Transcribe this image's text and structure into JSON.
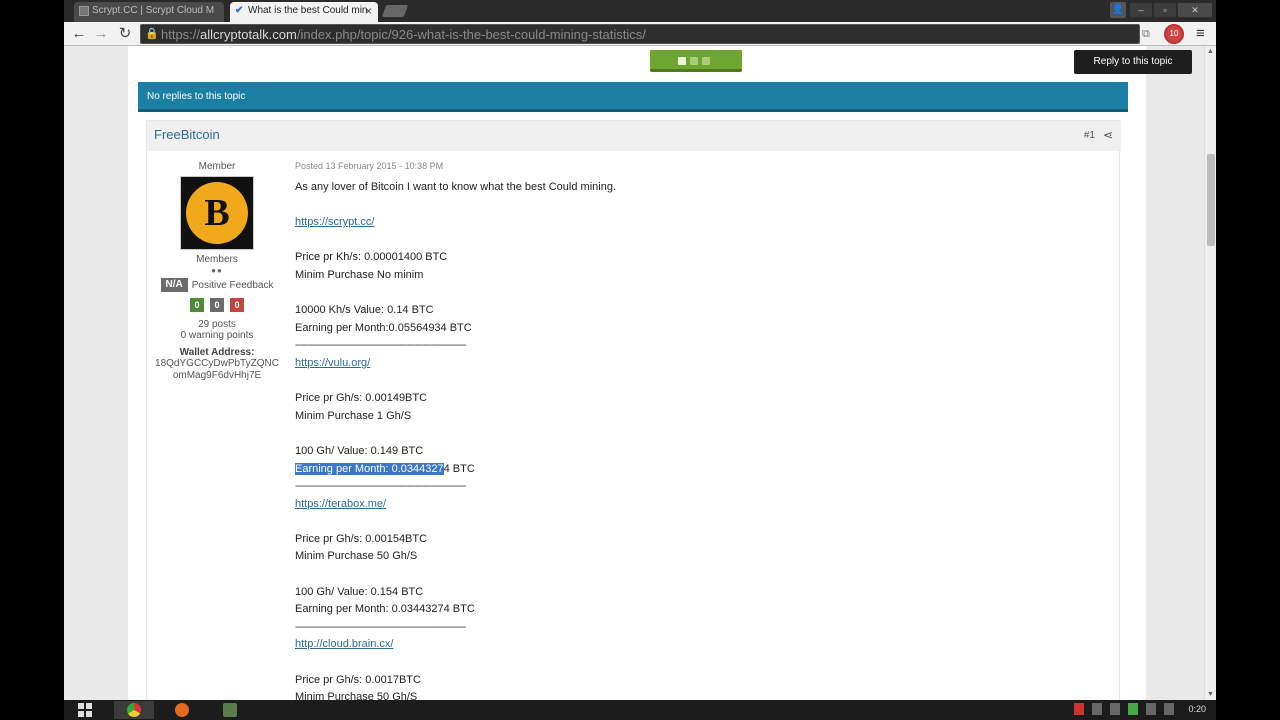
{
  "browser": {
    "tabs": [
      {
        "title": "Scrypt.CC | Scrypt Cloud M",
        "active": false
      },
      {
        "title": "What is the best Could min",
        "active": true
      }
    ],
    "url_scheme": "https://",
    "url_domain": "allcryptotalk.com",
    "url_path": "/index.php/topic/926-what-is-the-best-could-mining-statistics/",
    "extension_badge": "10"
  },
  "topic": {
    "reply_button": "Reply to this topic",
    "banner": "No replies to this topic"
  },
  "post": {
    "author": "FreeBitcoin",
    "number": "#1",
    "author_title": "Member",
    "avatar_symbol": "B",
    "group": "Members",
    "pips": "●●",
    "feedback_na": "N/A",
    "feedback_label": "Positive Feedback",
    "feedback_positive": "0",
    "feedback_neutral": "0",
    "feedback_negative": "0",
    "post_count": "29 posts",
    "warning_points": "0 warning points",
    "wallet_label": "Wallet Address:",
    "wallet_line1": "18QdYGCCyDwPbTyZQNC",
    "wallet_line2": "omMag9F6dvHhj7E",
    "posted": "Posted 13 February 2015 - 10:38 PM",
    "lines": {
      "intro": "As any lover of Bitcoin I want to know what the best Could mining.",
      "link1": "https://scrypt.cc/",
      "l1_price": "Price pr Kh/s: 0.00001400 BTC",
      "l1_min": "Minim Purchase No minim",
      "l1_value": "10000 Kh/s  Value: 0.14 BTC",
      "l1_earn": "Earning per Month:0.05564934 BTC",
      "rule": "----------------------------------------------------------------",
      "link2": "https://vulu.org/",
      "l2_price": "Price pr Gh/s: 0.00149BTC",
      "l2_min": "Minim Purchase 1 Gh/S",
      "l2_value": "100 Gh/ Value: 0.149 BTC",
      "l2_earn_selected": "Earning per Month: 0.0344327",
      "l2_earn_rest": "4 BTC",
      "link3": "https://terabox.me/",
      "l3_price": "Price pr Gh/s: 0.00154BTC",
      "l3_min": "Minim Purchase 50 Gh/S",
      "l3_value": "100 Gh/ Value: 0.154 BTC",
      "l3_earn": "Earning per Month: 0.03443274 BTC",
      "link4": "http://cloud.brain.cx/",
      "l4_price": "Price pr Gh/s: 0.0017BTC",
      "l4_min": "Minim Purchase 50 Gh/S"
    }
  },
  "taskbar": {
    "clock": "0:20"
  }
}
